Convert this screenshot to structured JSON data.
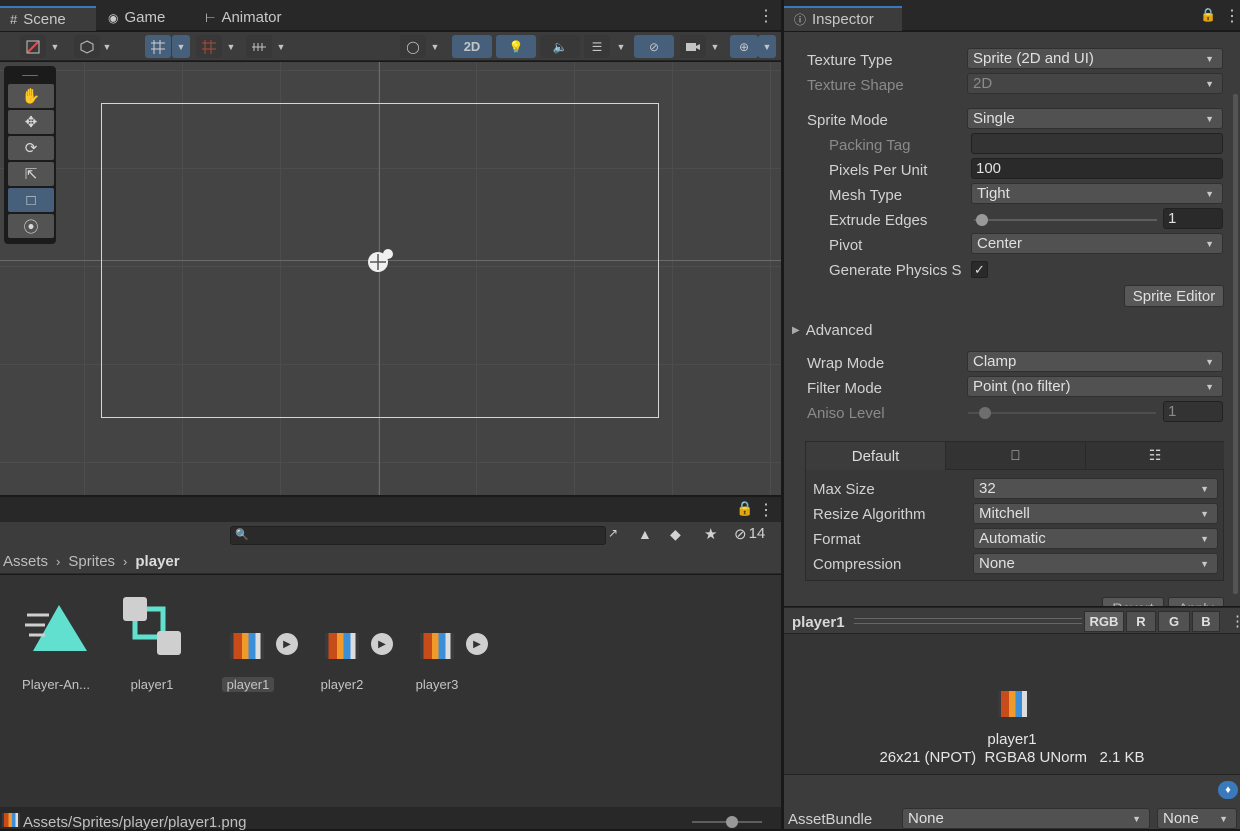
{
  "scene_tabs": [
    {
      "label": "Scene",
      "icon": "grid-icon"
    },
    {
      "label": "Game",
      "icon": "gamepad-icon"
    },
    {
      "label": "Animator",
      "icon": "animator-icon"
    }
  ],
  "scene_toolbar": {
    "mode_2d_label": "2D"
  },
  "project": {
    "search_placeholder": "",
    "hidden_count": "14",
    "breadcrumb": [
      "Assets",
      "Sprites",
      "player"
    ],
    "assets": [
      {
        "label": "Player-An...",
        "type": "animation-controller"
      },
      {
        "label": "player1",
        "type": "animation"
      },
      {
        "label": "player1",
        "type": "sprite",
        "selected": true
      },
      {
        "label": "player2",
        "type": "sprite"
      },
      {
        "label": "player3",
        "type": "sprite"
      }
    ],
    "status_path": "Assets/Sprites/player/player1.png"
  },
  "inspector": {
    "tab_label": "Inspector",
    "texture_type_label": "Texture Type",
    "texture_type_value": "Sprite (2D and UI)",
    "texture_shape_label": "Texture Shape",
    "texture_shape_value": "2D",
    "sprite_mode_label": "Sprite Mode",
    "sprite_mode_value": "Single",
    "packing_tag_label": "Packing Tag",
    "packing_tag_value": "",
    "ppu_label": "Pixels Per Unit",
    "ppu_value": "100",
    "mesh_type_label": "Mesh Type",
    "mesh_type_value": "Tight",
    "extrude_label": "Extrude Edges",
    "extrude_value": "1",
    "pivot_label": "Pivot",
    "pivot_value": "Center",
    "gen_physics_label": "Generate Physics S",
    "gen_physics_checked": true,
    "sprite_editor_label": "Sprite Editor",
    "advanced_label": "Advanced",
    "wrap_mode_label": "Wrap Mode",
    "wrap_mode_value": "Clamp",
    "filter_mode_label": "Filter Mode",
    "filter_mode_value": "Point (no filter)",
    "aniso_label": "Aniso Level",
    "aniso_value": "1",
    "platform_tabs": [
      "Default",
      "monitor-icon",
      "platform-icon"
    ],
    "max_size_label": "Max Size",
    "max_size_value": "32",
    "resize_label": "Resize Algorithm",
    "resize_value": "Mitchell",
    "format_label": "Format",
    "format_value": "Automatic",
    "compression_label": "Compression",
    "compression_value": "None",
    "revert_label": "Revert",
    "apply_label": "Apply"
  },
  "preview": {
    "title": "player1",
    "channels": [
      "RGB",
      "R",
      "G",
      "B"
    ],
    "name": "player1",
    "info": "26x21 (NPOT)  RGBA8 UNorm   2.1 KB"
  },
  "assetbundle": {
    "label": "AssetBundle",
    "name_value": "None",
    "variant_value": "None"
  }
}
